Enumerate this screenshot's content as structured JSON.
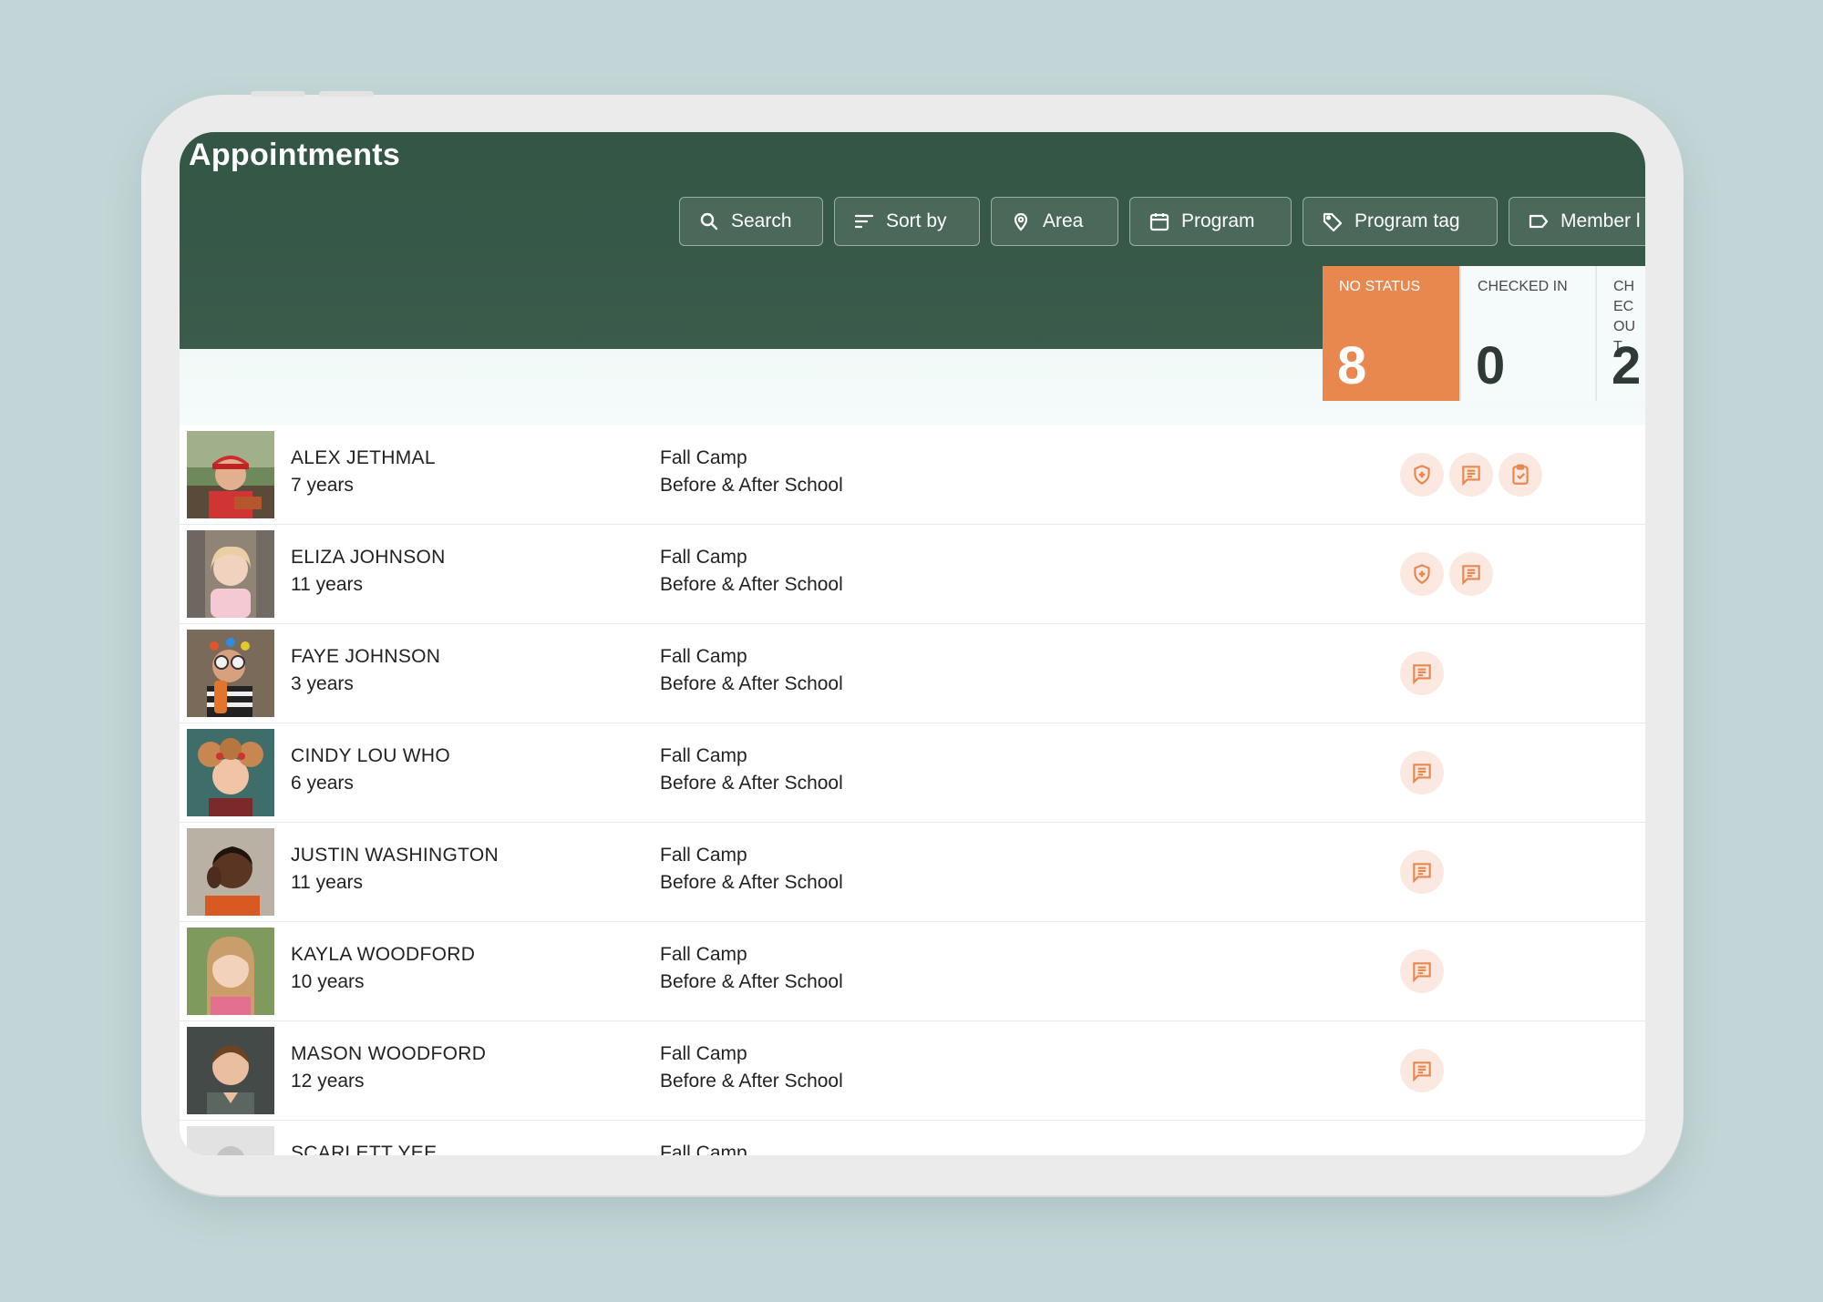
{
  "header": {
    "title": "Appointments"
  },
  "filters": [
    {
      "label": "Search",
      "icon": "search-icon"
    },
    {
      "label": "Sort by",
      "icon": "sort-icon"
    },
    {
      "label": "Area",
      "icon": "location-pin-icon"
    },
    {
      "label": "Program",
      "icon": "calendar-icon"
    },
    {
      "label": "Program tag",
      "icon": "tag-icon"
    },
    {
      "label": "Member l",
      "icon": "label-icon"
    }
  ],
  "statuses": [
    {
      "label": "NO STATUS",
      "count": "8",
      "active": true
    },
    {
      "label": "CHECKED IN",
      "count": "0",
      "active": false
    },
    {
      "label": "CHEC OUT",
      "count": "2",
      "active": false
    }
  ],
  "rows": [
    {
      "name": "ALEX JETHMAL",
      "age": "7 years",
      "program": "Fall Camp",
      "schedule": "Before & After School",
      "icons": [
        "shield-plus-icon",
        "notes-icon",
        "clipboard-check-icon"
      ]
    },
    {
      "name": "ELIZA JOHNSON",
      "age": "11 years",
      "program": "Fall Camp",
      "schedule": "Before & After School",
      "icons": [
        "shield-plus-icon",
        "notes-icon"
      ]
    },
    {
      "name": "FAYE JOHNSON",
      "age": "3 years",
      "program": "Fall Camp",
      "schedule": "Before & After School",
      "icons": [
        "notes-icon"
      ]
    },
    {
      "name": "CINDY LOU WHO",
      "age": "6 years",
      "program": "Fall Camp",
      "schedule": "Before & After School",
      "icons": [
        "notes-icon"
      ]
    },
    {
      "name": "JUSTIN WASHINGTON",
      "age": "11 years",
      "program": "Fall Camp",
      "schedule": "Before & After School",
      "icons": [
        "notes-icon"
      ]
    },
    {
      "name": "KAYLA WOODFORD",
      "age": "10 years",
      "program": "Fall Camp",
      "schedule": "Before & After School",
      "icons": [
        "notes-icon"
      ]
    },
    {
      "name": "MASON WOODFORD",
      "age": "12 years",
      "program": "Fall Camp",
      "schedule": "Before & After School",
      "icons": [
        "notes-icon"
      ]
    },
    {
      "name": "SCARLETT YEE",
      "age": "",
      "program": "Fall Camp",
      "schedule": "",
      "icons": []
    }
  ],
  "colors": {
    "header_green": "#3a5a4a",
    "accent_orange": "#e8884f",
    "icon_bg": "#fbe9e1"
  }
}
